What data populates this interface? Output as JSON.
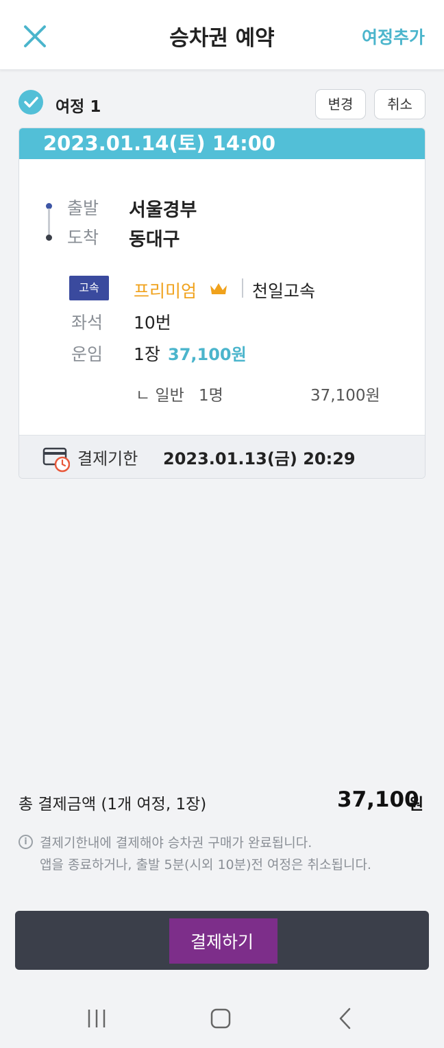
{
  "header": {
    "title": "승차권 예약",
    "add_trip_label": "여정추가"
  },
  "trip": {
    "label": "여정 1",
    "change_label": "변경",
    "cancel_label": "취소",
    "datetime": "2023.01.14(토) 14:00",
    "departure_label": "출발",
    "departure": "서울경부",
    "arrival_label": "도착",
    "arrival": "동대구",
    "bus_type_badge": "고속",
    "grade": "프리미엄",
    "company": "천일고속",
    "seat_label": "좌석",
    "seat": "10번",
    "fare_label": "운임",
    "ticket_count": "1장",
    "fare_amount": "37,100원",
    "passenger_prefix": "ㄴ 일반",
    "passenger_count": "1명",
    "passenger_fare": "37,100원",
    "deadline_label": "결제기한",
    "deadline": "2023.01.13(금) 20:29"
  },
  "summary": {
    "total_label": "총 결제금액 (1개 여정, 1장)",
    "total_amount": "37,100",
    "total_unit": "원",
    "info_line1": "결제기한내에 결제해야 승차권 구매가 완료됩니다.",
    "info_line2": "앱을 종료하거나, 출발 5분(시외 10분)전 여정은 취소됩니다."
  },
  "pay_button": {
    "label": "결제하기"
  },
  "colors": {
    "accent": "#52bfd7",
    "premium": "#f0a21c",
    "badge": "#3a4a9e",
    "pay_button": "#3b3f4a",
    "pay_highlight": "#7d2e8a"
  },
  "icons": {
    "close": "close-icon",
    "check": "check-icon",
    "crown": "crown-icon",
    "payment_deadline": "card-clock-icon",
    "info": "info-icon",
    "nav_recent": "recent-apps-icon",
    "nav_home": "home-icon",
    "nav_back": "back-icon"
  }
}
